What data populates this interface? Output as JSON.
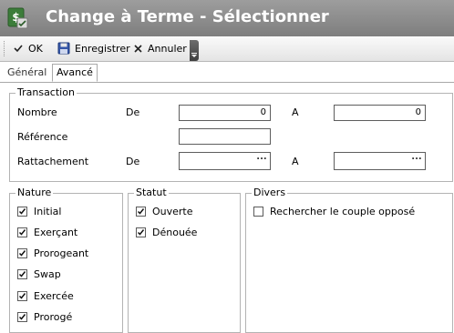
{
  "window": {
    "title": "Change à Terme - Sélectionner",
    "titlebar_color": "#8a8a8a"
  },
  "toolbar": {
    "ok_label": "OK",
    "save_label": "Enregistrer",
    "cancel_label": "Annuler"
  },
  "tabs": [
    {
      "label": "Général",
      "active": false
    },
    {
      "label": "Avancé",
      "active": true
    }
  ],
  "transaction": {
    "title": "Transaction",
    "nombre_label": "Nombre",
    "de_label": "De",
    "a_label": "A",
    "nombre_de_value": "0",
    "nombre_a_value": "0",
    "reference_label": "Référence",
    "reference_value": "",
    "rattachement_label": "Rattachement",
    "rattachement_de_label": "De",
    "rattachement_a_label": "A",
    "ellipsis": "..."
  },
  "nature": {
    "title": "Nature",
    "items": [
      {
        "label": "Initial",
        "checked": true
      },
      {
        "label": "Exerçant",
        "checked": true
      },
      {
        "label": "Prorogeant",
        "checked": true
      },
      {
        "label": "Swap",
        "checked": true
      },
      {
        "label": "Exercée",
        "checked": true
      },
      {
        "label": "Prorogé",
        "checked": true
      }
    ]
  },
  "statut": {
    "title": "Statut",
    "items": [
      {
        "label": "Ouverte",
        "checked": true
      },
      {
        "label": "Dénouée",
        "checked": true
      }
    ]
  },
  "divers": {
    "title": "Divers",
    "items": [
      {
        "label": "Rechercher le couple opposé",
        "checked": false
      }
    ]
  }
}
